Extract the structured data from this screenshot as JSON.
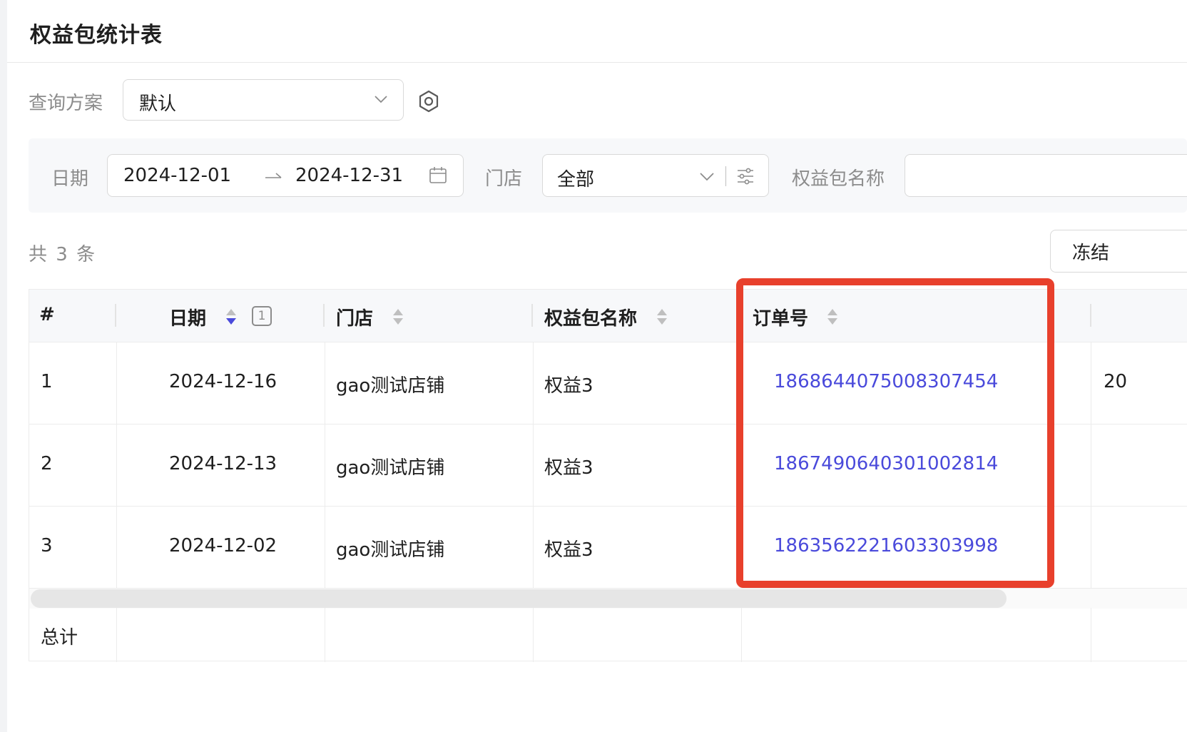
{
  "page_title": "权益包统计表",
  "query_scheme": {
    "label": "查询方案",
    "value": "默认"
  },
  "filters": {
    "date_label": "日期",
    "date_start": "2024-12-01",
    "date_end": "2024-12-31",
    "store_label": "门店",
    "store_value": "全部",
    "package_name_label": "权益包名称",
    "package_name_value": ""
  },
  "toolbar": {
    "total_text": "共 3 条",
    "freeze_label": "冻结"
  },
  "table": {
    "columns": [
      "#",
      "日期",
      "门店",
      "权益包名称",
      "订单号"
    ],
    "date_sort_order": "1",
    "rows": [
      {
        "index": "1",
        "date": "2024-12-16",
        "store": "gao测试店铺",
        "package": "权益3",
        "order_no": "1868644075008307454",
        "next_col": "20"
      },
      {
        "index": "2",
        "date": "2024-12-13",
        "store": "gao测试店铺",
        "package": "权益3",
        "order_no": "1867490640301002814",
        "next_col": ""
      },
      {
        "index": "3",
        "date": "2024-12-02",
        "store": "gao测试店铺",
        "package": "权益3",
        "order_no": "1863562221603303998",
        "next_col": ""
      }
    ],
    "footer_label": "总计"
  },
  "colors": {
    "accent": "#4a4adb",
    "highlight": "#e8402c",
    "muted": "#8c8c8c"
  }
}
